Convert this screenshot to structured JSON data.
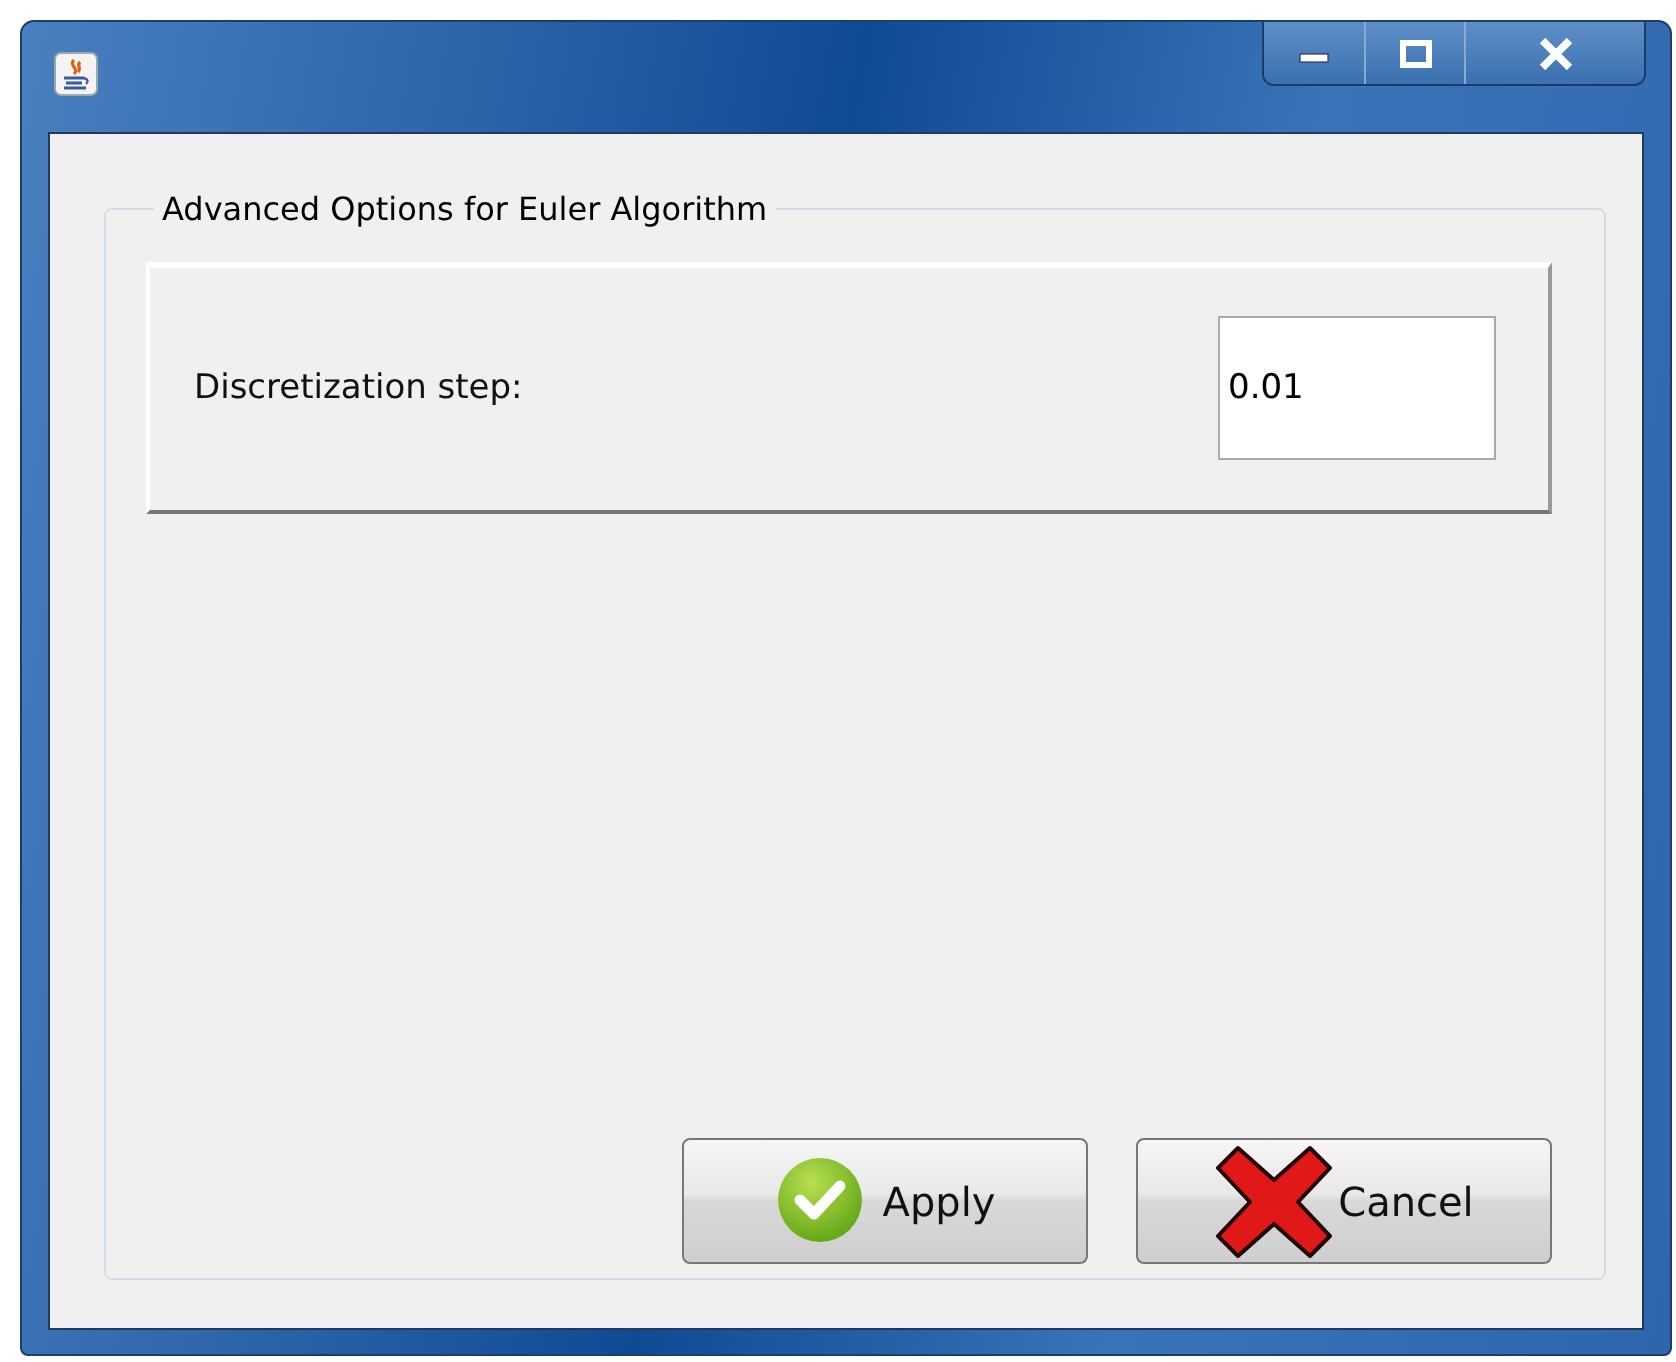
{
  "window": {
    "controls": [
      {
        "kind": "minimize"
      },
      {
        "kind": "maximize"
      },
      {
        "kind": "close"
      }
    ]
  },
  "group": {
    "title": "Advanced Options for Euler Algorithm"
  },
  "fields": [
    {
      "label": "Discretization step:",
      "value": "0.01"
    }
  ],
  "buttons": [
    {
      "kind": "apply",
      "label": "Apply"
    },
    {
      "kind": "cancel",
      "label": "Cancel"
    }
  ]
}
